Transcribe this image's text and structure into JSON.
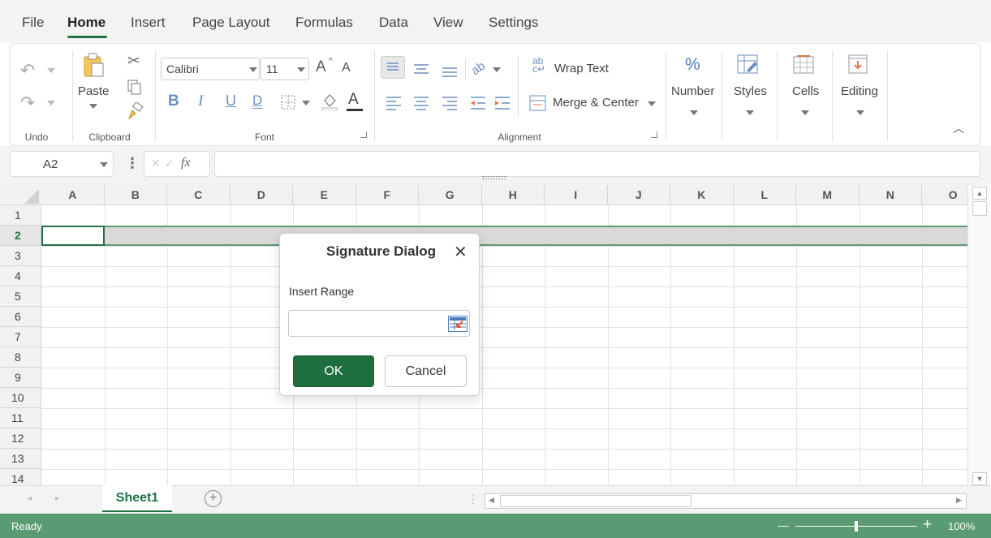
{
  "menu": {
    "items": [
      "File",
      "Home",
      "Insert",
      "Page Layout",
      "Formulas",
      "Data",
      "View",
      "Settings"
    ],
    "active": "Home"
  },
  "ribbon": {
    "groups": {
      "undo": "Undo",
      "clipboard": "Clipboard",
      "font": "Font",
      "alignment": "Alignment"
    },
    "paste_label": "Paste",
    "font_name": "Calibri",
    "font_size": "11",
    "font_buttons": {
      "bold": "B",
      "italic": "I",
      "underline": "U",
      "double_underline": "D",
      "font_color": "A",
      "grow": "A",
      "shrink": "A"
    },
    "wrap_text": "Wrap Text",
    "merge_center": "Merge & Center",
    "number": "Number",
    "number_symbol": "%",
    "styles": "Styles",
    "cells": "Cells",
    "editing": "Editing"
  },
  "formula_bar": {
    "name_box": "A2",
    "fx": "fx",
    "value": ""
  },
  "grid": {
    "columns": [
      "A",
      "B",
      "C",
      "D",
      "E",
      "F",
      "G",
      "H",
      "I",
      "J",
      "K",
      "L",
      "M",
      "N",
      "O"
    ],
    "rows": [
      "1",
      "2",
      "3",
      "4",
      "5",
      "6",
      "7",
      "8",
      "9",
      "10",
      "11",
      "12",
      "13",
      "14"
    ],
    "selected_row": "2"
  },
  "sheet_tabs": [
    "Sheet1"
  ],
  "status": {
    "text": "Ready",
    "zoom": "100%",
    "zoom_out": "—",
    "zoom_in": "+"
  },
  "dialog": {
    "title": "Signature Dialog",
    "close": "✕",
    "label": "Insert Range",
    "input_value": "",
    "ok": "OK",
    "cancel": "Cancel"
  },
  "colors": {
    "accent": "#217346",
    "ok_button": "#1e6e40",
    "status_bar": "#5b9b74"
  }
}
